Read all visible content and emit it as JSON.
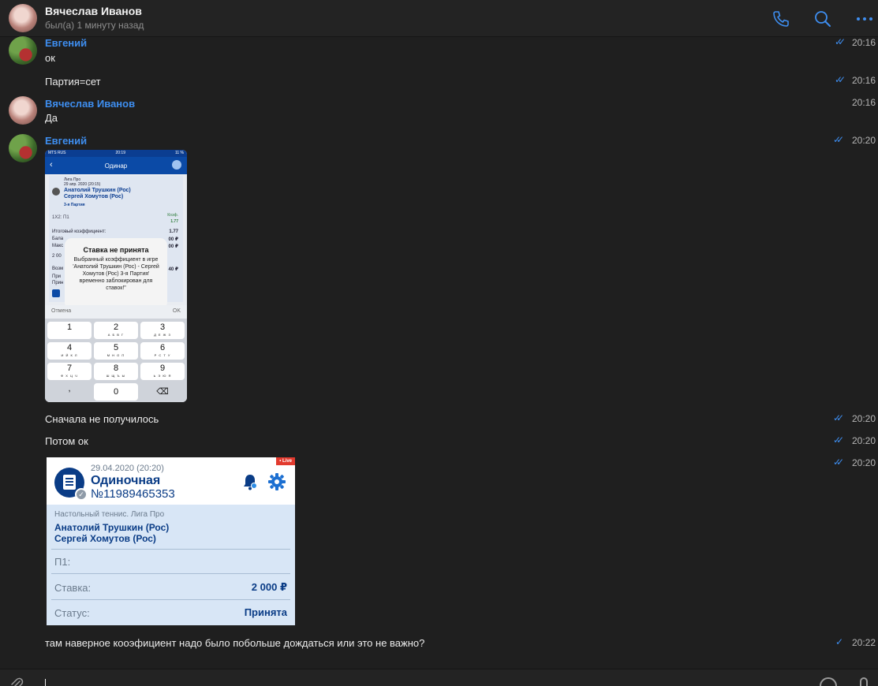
{
  "header": {
    "name": "Вячеслав Иванов",
    "status": "был(а) 1 минуту назад",
    "accent": "#3e8ef0",
    "icons": [
      "phone-icon",
      "search-icon",
      "more-icon"
    ]
  },
  "messages": [
    {
      "author": "Евгений",
      "text": "ок",
      "time": "20:16",
      "read": true
    },
    {
      "text": "Партия=сет",
      "time": "20:16",
      "read": true
    },
    {
      "author": "Вячеслав Иванов",
      "text": "Да",
      "time": "20:16"
    },
    {
      "author": "Евгений",
      "time": "20:20",
      "read": true
    },
    {
      "text": "Сначала не получилось",
      "time": "20:20",
      "read": true
    },
    {
      "text": "Потом ок",
      "time": "20:20",
      "read": true
    },
    {
      "time": "20:20",
      "read": true
    },
    {
      "text": "там наверное кооэфициент надо было побольше дождаться или это не важно?",
      "time": "20:22",
      "read": false
    }
  ],
  "phone_shot": {
    "status_carrier": "MTS RUS",
    "status_time": "20:19",
    "status_battery": "11 %",
    "nav_title": "Одинар",
    "league": "Лига Про",
    "datetime": "29 апр. 2020 (20:15)",
    "player1": "Анатолий Трушкин (Рос)",
    "player2": "Сергей Хомутов (Рос)",
    "game": "3-я Партия",
    "bet_line": "1Х2: П1",
    "koef_label": "Коэф.",
    "koef_value": "1.77",
    "total_label": "Итоговый коэффициент:",
    "total_value": "1.77",
    "row_bala": "Бала",
    "row_bala_val": "00 ₽",
    "row_maks": "Макс",
    "row_maks_val": "00 ₽",
    "row_amount": "2 00",
    "row_voz": "Возм",
    "row_voz_val": "40 ₽",
    "row_pri1": "При",
    "row_pri2": "Прин",
    "alert_title": "Ставка не принята",
    "alert_message": "Выбранный коэффициент в игре 'Анатолий Трушкин (Рос) - Сергей Хомутов (Рос) 3-я Партия' временно заблокирован для ставок!\"",
    "cancel": "Отмена",
    "ok": "OK",
    "keys": [
      {
        "n": "1",
        "s": ""
      },
      {
        "n": "2",
        "s": "А Б В Г"
      },
      {
        "n": "3",
        "s": "Д Е Ж З"
      },
      {
        "n": "4",
        "s": "И Й К Л"
      },
      {
        "n": "5",
        "s": "М Н О П"
      },
      {
        "n": "6",
        "s": "Р С Т У"
      },
      {
        "n": "7",
        "s": "Ф Х Ц Ч"
      },
      {
        "n": "8",
        "s": "Ш Щ Ъ Ы"
      },
      {
        "n": "9",
        "s": "Ь Э Ю Я"
      },
      {
        "n": ",",
        "s": ""
      },
      {
        "n": "0",
        "s": ""
      },
      {
        "n": "⌫",
        "s": ""
      }
    ]
  },
  "bet_slip": {
    "live": "• Live",
    "date": "29.04.2020 (20:20)",
    "title": "Одиночная",
    "number": "№11989465353",
    "category": "Настольный теннис. Лига Про",
    "player1": "Анатолий Трушкин (Рос)",
    "player2": "Сергей Хомутов (Рос)",
    "p1_label": "П1:",
    "stake_label": "Ставка:",
    "stake_value": "2 000 ₽",
    "status_label": "Статус:",
    "status_value": "Принята",
    "brand_color": "#0a3c86"
  }
}
